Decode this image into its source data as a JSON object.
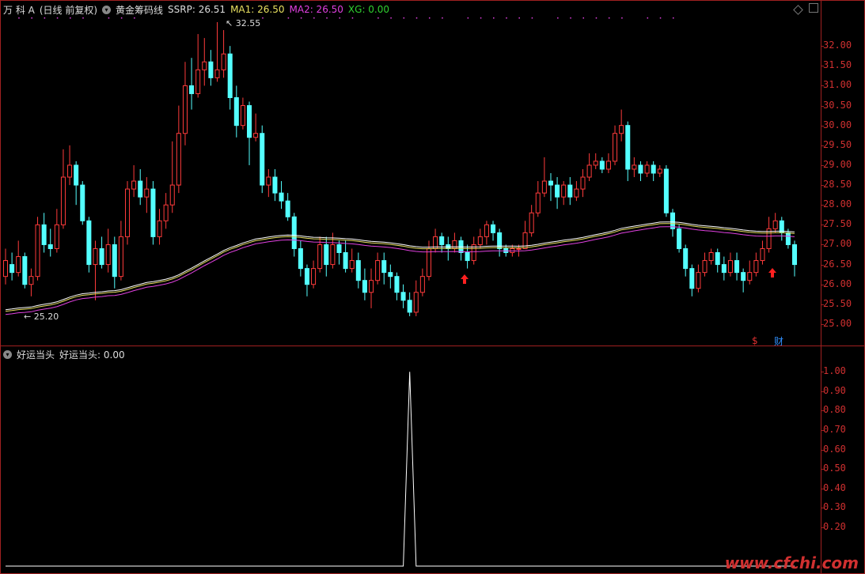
{
  "main": {
    "stock": "万 科 A",
    "period": "(日线 前复权)",
    "indicator": "黄金筹码线",
    "ssrp_label": "SSRP: 26.51",
    "ma1_label": "MA1: 26.50",
    "ma2_label": "MA2: 26.50",
    "xg_label": "XG: 0.00",
    "high_label": "32.55",
    "low_label": "25.20",
    "badge_s": "$",
    "badge_cai": "财",
    "y_axis": [
      "32.00",
      "31.50",
      "31.00",
      "30.50",
      "30.00",
      "29.50",
      "29.00",
      "28.50",
      "28.00",
      "27.50",
      "27.00",
      "26.50",
      "26.00",
      "25.50",
      "25.00"
    ]
  },
  "sub": {
    "title": "好运当头",
    "value_label": "好运当头: 0.00",
    "y_axis": [
      "1.00",
      "0.90",
      "0.80",
      "0.70",
      "0.60",
      "0.50",
      "0.40",
      "0.30",
      "0.20"
    ]
  },
  "watermark": "www.cfchi.com",
  "chart_data": {
    "type": "candlestick",
    "ylim": [
      24.9,
      32.6
    ],
    "x_count": 165,
    "candles": [
      [
        26.2,
        26.6,
        26.9,
        26.0
      ],
      [
        26.5,
        26.3,
        26.8,
        26.1
      ],
      [
        26.3,
        26.7,
        27.1,
        26.2
      ],
      [
        26.7,
        26.0,
        26.8,
        25.9
      ],
      [
        26.0,
        26.2,
        26.4,
        25.7
      ],
      [
        26.2,
        27.5,
        27.7,
        26.1
      ],
      [
        27.5,
        27.0,
        27.8,
        26.8
      ],
      [
        27.0,
        26.9,
        27.4,
        26.7
      ],
      [
        26.9,
        27.5,
        27.9,
        26.8
      ],
      [
        27.5,
        28.7,
        29.4,
        27.4
      ],
      [
        28.7,
        29.0,
        29.5,
        28.5
      ],
      [
        29.0,
        28.5,
        29.1,
        28.0
      ],
      [
        28.5,
        27.6,
        28.6,
        27.5
      ],
      [
        27.6,
        26.5,
        27.7,
        26.3
      ],
      [
        26.5,
        26.9,
        27.1,
        25.6
      ],
      [
        26.9,
        26.5,
        27.2,
        26.4
      ],
      [
        26.5,
        27.0,
        27.4,
        26.3
      ],
      [
        27.0,
        26.2,
        27.2,
        25.9
      ],
      [
        26.2,
        27.2,
        27.6,
        26.1
      ],
      [
        27.2,
        28.4,
        28.6,
        27.0
      ],
      [
        28.4,
        28.6,
        29.0,
        28.2
      ],
      [
        28.6,
        28.2,
        28.9,
        28.0
      ],
      [
        28.2,
        28.4,
        28.7,
        27.8
      ],
      [
        28.4,
        27.2,
        28.6,
        27.0
      ],
      [
        27.2,
        27.6,
        27.9,
        27.0
      ],
      [
        27.6,
        28.0,
        28.3,
        27.4
      ],
      [
        28.0,
        28.5,
        29.6,
        27.8
      ],
      [
        28.5,
        29.8,
        30.5,
        28.3
      ],
      [
        29.8,
        31.0,
        31.6,
        29.5
      ],
      [
        31.0,
        30.8,
        31.7,
        30.4
      ],
      [
        30.8,
        31.4,
        32.3,
        30.7
      ],
      [
        31.4,
        31.6,
        32.2,
        31.0
      ],
      [
        31.6,
        31.2,
        31.9,
        31.0
      ],
      [
        31.2,
        31.4,
        32.6,
        31.1
      ],
      [
        31.4,
        31.8,
        32.4,
        31.2
      ],
      [
        31.8,
        30.7,
        32.0,
        30.4
      ],
      [
        30.7,
        30.0,
        31.0,
        29.7
      ],
      [
        30.0,
        30.5,
        30.7,
        29.9
      ],
      [
        30.5,
        29.7,
        30.6,
        29.0
      ],
      [
        29.7,
        29.8,
        30.3,
        29.6
      ],
      [
        29.8,
        28.5,
        30.0,
        28.3
      ],
      [
        28.5,
        28.7,
        28.9,
        28.2
      ],
      [
        28.7,
        28.3,
        28.9,
        28.1
      ],
      [
        28.3,
        28.1,
        28.6,
        27.9
      ],
      [
        28.1,
        27.7,
        28.3,
        27.6
      ],
      [
        27.7,
        26.9,
        27.8,
        26.7
      ],
      [
        26.9,
        26.4,
        27.1,
        26.2
      ],
      [
        26.4,
        26.0,
        26.5,
        25.7
      ],
      [
        26.0,
        26.4,
        26.6,
        25.9
      ],
      [
        26.4,
        27.0,
        27.2,
        26.3
      ],
      [
        27.0,
        26.5,
        27.2,
        26.2
      ],
      [
        26.5,
        27.0,
        27.3,
        26.4
      ],
      [
        27.0,
        26.8,
        27.1,
        26.5
      ],
      [
        26.8,
        26.4,
        27.1,
        26.3
      ],
      [
        26.4,
        26.6,
        26.9,
        26.3
      ],
      [
        26.6,
        26.1,
        26.8,
        25.9
      ],
      [
        26.1,
        25.8,
        26.4,
        25.6
      ],
      [
        25.8,
        26.1,
        26.4,
        25.4
      ],
      [
        26.1,
        26.6,
        26.8,
        26.0
      ],
      [
        26.6,
        26.3,
        26.8,
        26.0
      ],
      [
        26.3,
        26.2,
        26.5,
        25.9
      ],
      [
        26.2,
        25.8,
        26.3,
        25.6
      ],
      [
        25.8,
        25.6,
        26.0,
        25.4
      ],
      [
        25.6,
        25.3,
        25.8,
        25.2
      ],
      [
        25.3,
        25.8,
        26.1,
        25.2
      ],
      [
        25.8,
        26.2,
        26.4,
        25.7
      ],
      [
        26.2,
        26.9,
        27.1,
        26.1
      ],
      [
        26.9,
        27.2,
        27.4,
        26.8
      ],
      [
        27.2,
        27.0,
        27.3,
        26.8
      ],
      [
        27.0,
        26.9,
        27.2,
        26.6
      ],
      [
        26.9,
        27.1,
        27.3,
        26.8
      ],
      [
        27.1,
        26.8,
        27.2,
        26.6
      ],
      [
        26.8,
        26.6,
        27.0,
        26.4
      ],
      [
        26.6,
        27.0,
        27.2,
        26.5
      ],
      [
        27.0,
        27.2,
        27.4,
        26.9
      ],
      [
        27.2,
        27.5,
        27.6,
        27.0
      ],
      [
        27.5,
        27.3,
        27.6,
        27.1
      ],
      [
        27.3,
        26.9,
        27.4,
        26.7
      ],
      [
        26.9,
        26.8,
        27.0,
        26.7
      ],
      [
        26.8,
        26.9,
        27.0,
        26.7
      ],
      [
        26.9,
        26.9,
        27.0,
        26.7
      ],
      [
        26.9,
        27.3,
        27.6,
        26.9
      ],
      [
        27.3,
        27.8,
        28.0,
        27.2
      ],
      [
        27.8,
        28.3,
        28.6,
        27.7
      ],
      [
        28.3,
        28.6,
        29.2,
        28.2
      ],
      [
        28.6,
        28.5,
        28.8,
        28.1
      ],
      [
        28.5,
        28.2,
        28.7,
        27.9
      ],
      [
        28.2,
        28.5,
        28.6,
        28.0
      ],
      [
        28.5,
        28.2,
        28.7,
        28.0
      ],
      [
        28.2,
        28.4,
        28.6,
        28.1
      ],
      [
        28.4,
        28.7,
        28.9,
        28.2
      ],
      [
        28.7,
        29.0,
        29.3,
        28.6
      ],
      [
        29.0,
        29.1,
        29.3,
        28.9
      ],
      [
        29.1,
        28.9,
        29.2,
        28.8
      ],
      [
        28.9,
        29.1,
        29.3,
        28.8
      ],
      [
        29.1,
        29.8,
        30.0,
        29.0
      ],
      [
        29.8,
        30.0,
        30.4,
        29.6
      ],
      [
        30.0,
        28.9,
        30.1,
        28.6
      ],
      [
        28.9,
        29.0,
        29.2,
        28.7
      ],
      [
        29.0,
        28.8,
        29.1,
        28.6
      ],
      [
        28.8,
        29.0,
        29.1,
        28.7
      ],
      [
        29.0,
        28.8,
        29.1,
        28.6
      ],
      [
        28.8,
        28.9,
        29.0,
        28.7
      ],
      [
        28.9,
        27.8,
        29.0,
        27.7
      ],
      [
        27.8,
        27.4,
        27.9,
        27.2
      ],
      [
        27.4,
        26.9,
        27.5,
        26.8
      ],
      [
        26.9,
        26.4,
        27.0,
        26.2
      ],
      [
        26.4,
        25.9,
        26.5,
        25.7
      ],
      [
        25.9,
        26.3,
        26.5,
        25.8
      ],
      [
        26.3,
        26.6,
        26.8,
        26.2
      ],
      [
        26.6,
        26.8,
        26.9,
        26.5
      ],
      [
        26.8,
        26.5,
        26.9,
        26.3
      ],
      [
        26.5,
        26.3,
        26.7,
        26.1
      ],
      [
        26.3,
        26.6,
        26.8,
        26.2
      ],
      [
        26.6,
        26.3,
        26.8,
        26.1
      ],
      [
        26.3,
        26.1,
        26.4,
        25.8
      ],
      [
        26.1,
        26.3,
        26.6,
        26.0
      ],
      [
        26.3,
        26.6,
        26.8,
        26.2
      ],
      [
        26.6,
        26.9,
        27.1,
        26.5
      ],
      [
        26.9,
        27.4,
        27.7,
        26.8
      ],
      [
        27.4,
        27.6,
        27.8,
        27.3
      ],
      [
        27.6,
        27.3,
        27.7,
        27.1
      ],
      [
        27.3,
        27.0,
        27.4,
        26.9
      ],
      [
        27.0,
        26.5,
        27.1,
        26.2
      ]
    ]
  },
  "sub_chart_data": {
    "type": "line",
    "ylim": [
      0,
      1.05
    ],
    "series_values_note": "",
    "spike_index": 63,
    "spike_value": 1.0
  }
}
